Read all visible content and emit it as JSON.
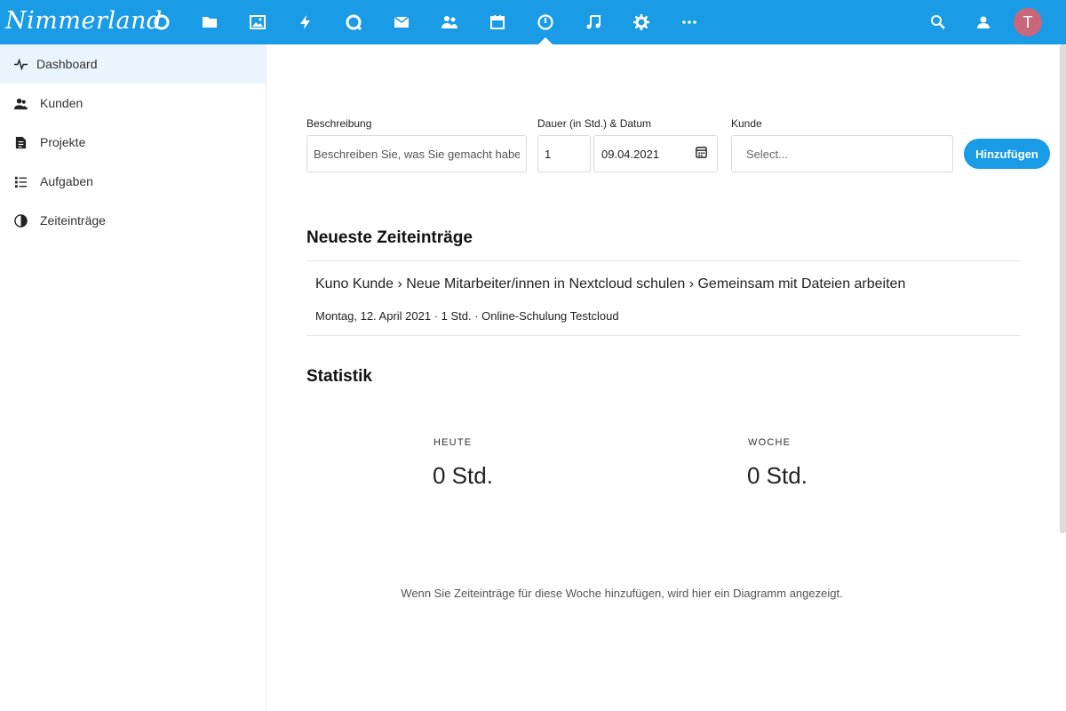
{
  "header": {
    "logo_text": "Nimmerland",
    "apps": [
      {
        "icon": "dashboard-circle-icon"
      },
      {
        "icon": "files-folder-icon"
      },
      {
        "icon": "photos-icon"
      },
      {
        "icon": "activity-bolt-icon"
      },
      {
        "icon": "talk-chat-icon"
      },
      {
        "icon": "mail-icon"
      },
      {
        "icon": "contacts-icon"
      },
      {
        "icon": "calendar-icon"
      },
      {
        "icon": "timemanager-clock-icon",
        "active": true
      },
      {
        "icon": "music-icon"
      },
      {
        "icon": "settings-gear-icon"
      },
      {
        "icon": "more-apps-icon"
      }
    ],
    "avatar_initial": "T"
  },
  "sidebar": {
    "items": [
      {
        "label": "Dashboard",
        "icon": "activity-pulse-icon",
        "active": true
      },
      {
        "label": "Kunden",
        "icon": "clients-icon"
      },
      {
        "label": "Projekte",
        "icon": "projects-document-icon"
      },
      {
        "label": "Aufgaben",
        "icon": "tasks-list-icon"
      },
      {
        "label": "Zeiteinträge",
        "icon": "time-entries-pie-icon"
      }
    ]
  },
  "form": {
    "description_label": "Beschreibung",
    "description_placeholder": "Beschreiben Sie, was Sie gemacht haben.",
    "duration_label": "Dauer (in Std.) & Datum",
    "duration_value": "1",
    "date_value": "09.04.2021",
    "customer_label": "Kunde",
    "customer_placeholder": "Select...",
    "add_button_label": "Hinzufügen"
  },
  "recent": {
    "title": "Neueste Zeiteinträge",
    "entries": [
      {
        "path": "Kuno Kunde › Neue Mitarbeiter/innen in Nextcloud schulen › Gemeinsam mit Dateien arbeiten",
        "meta": "Montag, 12. April 2021 · 1 Std. · Online-Schulung Testcloud"
      }
    ]
  },
  "statistics": {
    "title": "Statistik",
    "today_label": "HEUTE",
    "today_value": "0 Std.",
    "week_label": "WOCHE",
    "week_value": "0 Std.",
    "empty_chart_text": "Wenn Sie Zeiteinträge für diese Woche hinzufügen, wird hier ein Diagramm angezeigt."
  },
  "colors": {
    "header_bg": "#1a9be6",
    "active_nav_bg": "#e9f4fc",
    "avatar_bg": "#c9677a"
  }
}
